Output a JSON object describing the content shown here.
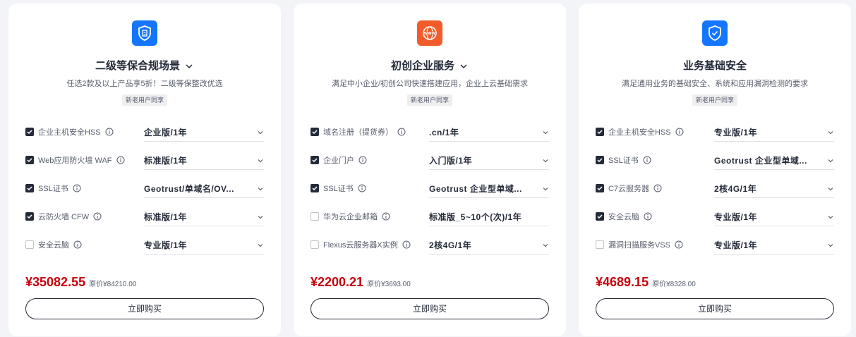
{
  "colors": {
    "accent_blue": "#1476ff",
    "accent_orange": "#f25c2a",
    "price_red": "#c7000b"
  },
  "cards": [
    {
      "icon": "shield-document-icon",
      "title": "二级等保合规场景",
      "desc": "任选2款及以上产品享5折！二级等保整改优选",
      "tag": "新老用户同享",
      "rows": [
        {
          "label": "企业主机安全HSS",
          "checked": true,
          "value": "企业版/1年"
        },
        {
          "label": "Web应用防火墙 WAF",
          "checked": true,
          "value": "标准版/1年"
        },
        {
          "label": "SSL证书",
          "checked": true,
          "value": "Geotrust/单域名/OV..."
        },
        {
          "label": "云防火墙 CFW",
          "checked": true,
          "value": "标准版/1年"
        },
        {
          "label": "安全云脑",
          "checked": false,
          "value": "专业版/1年"
        }
      ],
      "price": "¥35082.55",
      "orig_price": "原价¥84210.00",
      "buy_label": "立即购买"
    },
    {
      "icon": "www-globe-icon",
      "title": "初创企业服务",
      "desc": "满足中小企业/初创公司快速搭建应用，企业上云基础需求",
      "tag": "新老用户同享",
      "rows": [
        {
          "label": "域名注册（提货券）",
          "checked": true,
          "value": ".cn/1年"
        },
        {
          "label": "企业门户",
          "checked": true,
          "value": "入门版/1年"
        },
        {
          "label": "SSL证书",
          "checked": true,
          "value": "Geotrust 企业型单域..."
        },
        {
          "label": "华为云企业邮箱",
          "checked": false,
          "value": "标准版_5~10个(次)/1年"
        },
        {
          "label": "Flexus云服务器X实例",
          "checked": false,
          "value": "2核4G/1年"
        }
      ],
      "price": "¥2200.21",
      "orig_price": "原价¥3693.00",
      "buy_label": "立即购买"
    },
    {
      "icon": "shield-check-icon",
      "title": "业务基础安全",
      "desc": "满足通用业务的基础安全、系统和应用漏洞检测的要求",
      "tag": "新老用户同享",
      "rows": [
        {
          "label": "企业主机安全HSS",
          "checked": true,
          "value": "专业版/1年"
        },
        {
          "label": "SSL证书",
          "checked": true,
          "value": "Geotrust 企业型单域..."
        },
        {
          "label": "C7云服务器",
          "checked": true,
          "value": "2核4G/1年"
        },
        {
          "label": "安全云脑",
          "checked": true,
          "value": "专业版/1年"
        },
        {
          "label": "漏洞扫描服务VSS",
          "checked": false,
          "value": "专业版/1年"
        }
      ],
      "price": "¥4689.15",
      "orig_price": "原价¥8328.00",
      "buy_label": "立即购买"
    }
  ]
}
